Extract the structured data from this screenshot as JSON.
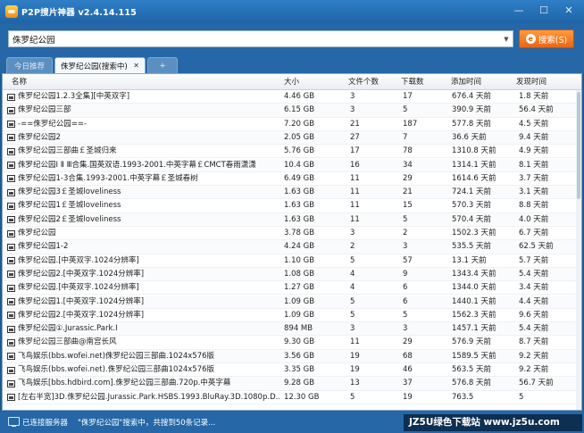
{
  "window": {
    "title": "P2P搜片神器 v2.4.14.115",
    "controls": [
      "minimize-icon",
      "maximize-icon",
      "close-icon"
    ]
  },
  "search": {
    "value": "侏罗纪公园",
    "button_label": "搜索(S)",
    "button_icon": "e"
  },
  "tabs": [
    {
      "label": "今日推荐",
      "active": false
    },
    {
      "label": "侏罗纪公园(搜索中)",
      "active": true,
      "close": "✕"
    },
    {
      "label": "+",
      "active": false
    }
  ],
  "columns": [
    "名称",
    "大小",
    "文件个数",
    "下载数",
    "添加时间",
    "发现时间"
  ],
  "rows": [
    {
      "name": "侏罗纪公园1.2.3全集][中英双字]",
      "size": "4.46 GB",
      "count": "3",
      "dl": "17",
      "added": "676.4 天前",
      "found": "1.8 天前"
    },
    {
      "name": "侏罗纪公园三部",
      "size": "6.15 GB",
      "count": "3",
      "dl": "5",
      "added": "390.9 天前",
      "found": "56.4 天前"
    },
    {
      "name": "-==侏罗纪公园==-",
      "size": "7.20 GB",
      "count": "21",
      "dl": "187",
      "added": "577.8 天前",
      "found": "4.5 天前"
    },
    {
      "name": "侏罗纪公园2",
      "size": "2.05 GB",
      "count": "27",
      "dl": "7",
      "added": "36.6 天前",
      "found": "9.4 天前"
    },
    {
      "name": "侏罗纪公园三部曲￡圣城归来",
      "size": "5.76 GB",
      "count": "17",
      "dl": "78",
      "added": "1310.8 天前",
      "found": "4.9 天前"
    },
    {
      "name": "侏罗纪公园Ⅰ Ⅱ Ⅲ合集.国英双语.1993-2001.中英字幕￡CMCT春雨潇潇",
      "size": "10.4 GB",
      "count": "16",
      "dl": "34",
      "added": "1314.1 天前",
      "found": "8.1 天前"
    },
    {
      "name": "侏罗纪公园1-3合集.1993-2001.中英字幕￡圣城春树",
      "size": "6.49 GB",
      "count": "11",
      "dl": "29",
      "added": "1614.6 天前",
      "found": "3.7 天前"
    },
    {
      "name": "侏罗纪公园3￡圣城loveliness",
      "size": "1.63 GB",
      "count": "11",
      "dl": "21",
      "added": "724.1 天前",
      "found": "3.1 天前"
    },
    {
      "name": "侏罗纪公园1￡圣城loveliness",
      "size": "1.63 GB",
      "count": "11",
      "dl": "15",
      "added": "570.3 天前",
      "found": "8.8 天前"
    },
    {
      "name": "侏罗纪公园2￡圣城loveliness",
      "size": "1.63 GB",
      "count": "11",
      "dl": "5",
      "added": "570.4 天前",
      "found": "4.0 天前"
    },
    {
      "name": "侏罗纪公园",
      "size": "3.78 GB",
      "count": "3",
      "dl": "2",
      "added": "1502.3 天前",
      "found": "6.7 天前"
    },
    {
      "name": "侏罗纪公园1-2",
      "size": "4.24 GB",
      "count": "2",
      "dl": "3",
      "added": "535.5 天前",
      "found": "62.5 天前"
    },
    {
      "name": "侏罗纪公园.[中英双字.1024分辨率]",
      "size": "1.10 GB",
      "count": "5",
      "dl": "57",
      "added": "13.1 天前",
      "found": "5.7 天前"
    },
    {
      "name": "侏罗纪公园2.[中英双字.1024分辨率]",
      "size": "1.08 GB",
      "count": "4",
      "dl": "9",
      "added": "1343.4 天前",
      "found": "5.4 天前"
    },
    {
      "name": "侏罗纪公园.[中英双字.1024分辨率]",
      "size": "1.27 GB",
      "count": "4",
      "dl": "6",
      "added": "1344.0 天前",
      "found": "3.4 天前"
    },
    {
      "name": "侏罗纪公园1.[中英双字.1024分辨率]",
      "size": "1.09 GB",
      "count": "5",
      "dl": "6",
      "added": "1440.1 天前",
      "found": "4.4 天前"
    },
    {
      "name": "侏罗纪公园2.[中英双字.1024分辨率]",
      "size": "1.09 GB",
      "count": "5",
      "dl": "5",
      "added": "1562.3 天前",
      "found": "9.6 天前"
    },
    {
      "name": "侏罗纪公园①.Jurassic.Park.Ⅰ",
      "size": "894 MB",
      "count": "3",
      "dl": "3",
      "added": "1457.1 天前",
      "found": "5.4 天前"
    },
    {
      "name": "侏罗纪公园三部曲@南宫长风",
      "size": "9.30 GB",
      "count": "11",
      "dl": "29",
      "added": "576.9 天前",
      "found": "8.7 天前"
    },
    {
      "name": "飞鸟娱乐(bbs.wofei.net)侏罗纪公园三部曲.1024x576版",
      "size": "3.56 GB",
      "count": "19",
      "dl": "68",
      "added": "1589.5 天前",
      "found": "9.2 天前"
    },
    {
      "name": "飞鸟娱乐(bbs.wofei.net).侏罗纪公园三部曲1024x576版",
      "size": "3.35 GB",
      "count": "19",
      "dl": "46",
      "added": "563.5 天前",
      "found": "9.2 天前"
    },
    {
      "name": "飞鸟娱乐[bbs.hdbird.com].侏罗纪公园三部曲.720p.中英字幕",
      "size": "9.28 GB",
      "count": "13",
      "dl": "37",
      "added": "576.8 天前",
      "found": "56.7 天前"
    },
    {
      "name": "[左右半宽]3D.侏罗纪公园.Jurassic.Park.HSBS.1993.BluRay.3D.1080p.D...",
      "size": "12.30 GB",
      "count": "5",
      "dl": "19",
      "added": "763.5",
      "found": "5"
    }
  ],
  "status": {
    "connection": "已连接服务器",
    "message": "\"侏罗纪公园\"搜索中，共搜到50条记录..."
  },
  "watermark": "JZ5U绿色下载站 www.jz5u.com",
  "colors": {
    "titlebar": "#1e64a6",
    "accent_orange": "#ee6410",
    "panel_blue": "#2567a7"
  }
}
